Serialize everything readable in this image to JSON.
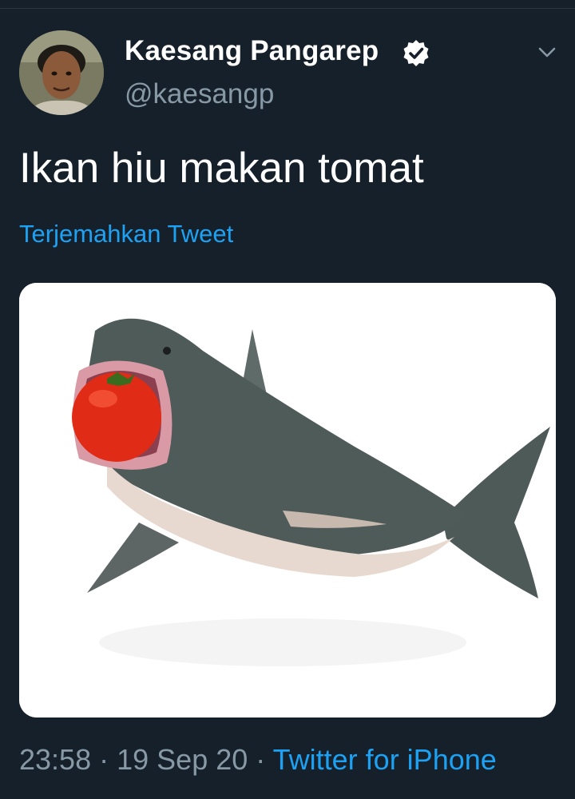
{
  "tweet": {
    "display_name": "Kaesang Pangarep",
    "handle": "@kaesangp",
    "text": "Ikan hiu makan tomat",
    "translate_label": "Terjemahkan Tweet",
    "time": "23:58",
    "date": "19 Sep 20",
    "separator": "·",
    "source": "Twitter for iPhone",
    "icons": {
      "verified": "verified-badge-icon",
      "caret": "chevron-down-icon",
      "media": "shark-eating-tomato-image"
    },
    "colors": {
      "background": "#15202b",
      "link": "#1da1f2",
      "secondary_text": "#8899a6",
      "primary_text": "#ffffff"
    }
  }
}
